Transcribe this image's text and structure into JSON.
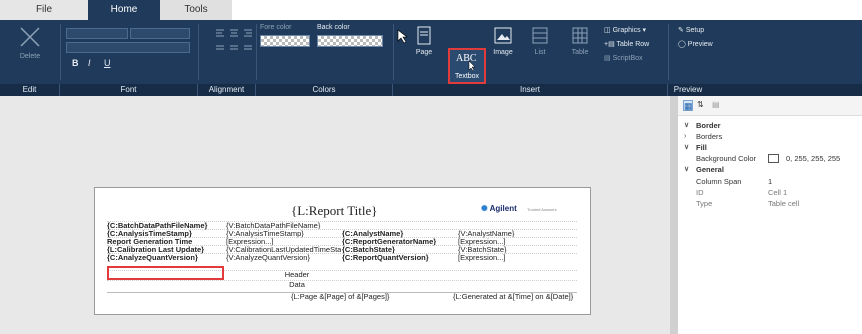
{
  "tabs": [
    "File",
    "Home",
    "Tools"
  ],
  "edit": {
    "delete": "Delete",
    "group": "Edit"
  },
  "font": {
    "bold": "B",
    "italic": "I",
    "underline": "U",
    "group": "Font"
  },
  "alignment": {
    "group": "Alignment"
  },
  "colors": {
    "fore": "Fore color",
    "back": "Back color",
    "group": "Colors"
  },
  "insert": {
    "page": "Page",
    "textbox": "Textbox",
    "textbox_glyph": "ABC",
    "image": "Image",
    "list": "List",
    "table": "Table",
    "graphics": "Graphics",
    "table_row": "Table Row",
    "scriptbox": "ScriptBox",
    "group": "Insert"
  },
  "preview": {
    "setup": "Setup",
    "preview": "Preview",
    "group": "Preview"
  },
  "report": {
    "title": "{L:Report Title}",
    "logo": "Agilent",
    "logo_tag": "Trusted Answers",
    "rows": [
      [
        "{C:BatchDataPathFileName}",
        "{V:BatchDataPathFileName}",
        "",
        ""
      ],
      [
        "{C:AnalysisTimeStamp}",
        "{V:AnalysisTimeStamp}",
        "{C:AnalystName}",
        "{V:AnalystName}"
      ],
      [
        "Report Generation Time",
        "[Expression...]",
        "{C:ReportGeneratorName}",
        "[Expression...]"
      ],
      [
        "{L:Calibration Last Update}",
        "{V:CalibrationLastUpdatedTimeStam",
        "{C:BatchState}",
        "{V:BatchState}"
      ],
      [
        "{C:AnalyzeQuantVersion}",
        "{V:AnalyzeQuantVersion}",
        "{C:ReportQuantVersion}",
        "[Expression...]"
      ]
    ],
    "header": "Header",
    "data": "Data",
    "footer_left": "{L:Page &[Page] of &[Pages]}",
    "footer_right": "{L:Generated at &[Time] on &[Date]}"
  },
  "props": {
    "border": "Border",
    "borders": "Borders",
    "fill": "Fill",
    "bg_color_label": "Background Color",
    "bg_color_value": "0, 255, 255, 255",
    "general": "General",
    "colspan_label": "Column Span",
    "colspan_value": "1",
    "id_label": "ID",
    "id_value": "Cell 1",
    "type_label": "Type",
    "type_value": "Table cell"
  }
}
